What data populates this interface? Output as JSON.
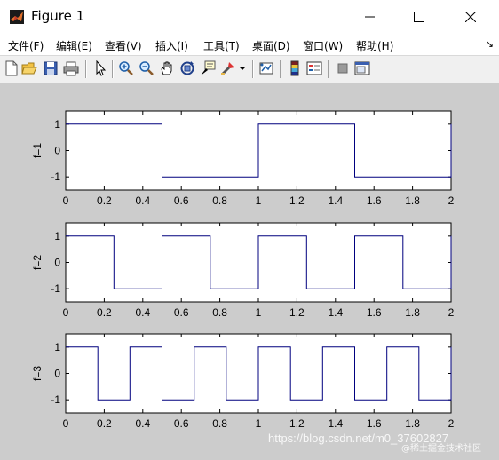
{
  "window": {
    "title": "Figure 1",
    "controls": [
      "minimize",
      "maximize",
      "close"
    ]
  },
  "menu": {
    "items": [
      "文件(F)",
      "编辑(E)",
      "查看(V)",
      "插入(I)",
      "工具(T)",
      "桌面(D)",
      "窗口(W)",
      "帮助(H)"
    ]
  },
  "toolbar": {
    "icons": [
      "new-figure-icon",
      "open-file-icon",
      "save-icon",
      "print-icon",
      "arrow-select-icon",
      "zoom-in-icon",
      "zoom-out-icon",
      "pan-hand-icon",
      "rotate-3d-icon",
      "data-cursor-icon",
      "brush-icon",
      "brush-dropdown-icon",
      "link-plot-icon",
      "colorbar-icon",
      "legend-icon",
      "hide-plot-tools-icon",
      "show-plot-tools-icon"
    ]
  },
  "colors": {
    "line": "#00007f",
    "axes_bg": "#ffffff",
    "figure_bg": "#cccccc"
  },
  "chart_data": [
    {
      "type": "line",
      "ylabel": "f=1",
      "xlim": [
        0,
        2
      ],
      "ylim": [
        -1.5,
        1.5
      ],
      "xticks": [
        "0",
        "0.2",
        "0.4",
        "0.6",
        "0.8",
        "1",
        "1.2",
        "1.4",
        "1.6",
        "1.8",
        "2"
      ],
      "yticks": [
        "1",
        "0",
        "-1"
      ],
      "series": [
        {
          "x": [
            0,
            0.5,
            0.5,
            1,
            1,
            1.5,
            1.5,
            2,
            2
          ],
          "y": [
            1,
            1,
            -1,
            -1,
            1,
            1,
            -1,
            -1,
            1
          ]
        }
      ]
    },
    {
      "type": "line",
      "ylabel": "f=2",
      "xlim": [
        0,
        2
      ],
      "ylim": [
        -1.5,
        1.5
      ],
      "xticks": [
        "0",
        "0.2",
        "0.4",
        "0.6",
        "0.8",
        "1",
        "1.2",
        "1.4",
        "1.6",
        "1.8",
        "2"
      ],
      "yticks": [
        "1",
        "0",
        "-1"
      ],
      "series": [
        {
          "x": [
            0,
            0.25,
            0.25,
            0.5,
            0.5,
            0.75,
            0.75,
            1,
            1,
            1.25,
            1.25,
            1.5,
            1.5,
            1.75,
            1.75,
            2,
            2
          ],
          "y": [
            1,
            1,
            -1,
            -1,
            1,
            1,
            -1,
            -1,
            1,
            1,
            -1,
            -1,
            1,
            1,
            -1,
            -1,
            1
          ]
        }
      ]
    },
    {
      "type": "line",
      "ylabel": "f=3",
      "xlim": [
        0,
        2
      ],
      "ylim": [
        -1.5,
        1.5
      ],
      "xticks": [
        "0",
        "0.2",
        "0.4",
        "0.6",
        "0.8",
        "1",
        "1.2",
        "1.4",
        "1.6",
        "1.8",
        "2"
      ],
      "yticks": [
        "1",
        "0",
        "-1"
      ],
      "series": [
        {
          "x": [
            0,
            0.1667,
            0.1667,
            0.3333,
            0.3333,
            0.5,
            0.5,
            0.6667,
            0.6667,
            0.8333,
            0.8333,
            1,
            1,
            1.1667,
            1.1667,
            1.3333,
            1.3333,
            1.5,
            1.5,
            1.6667,
            1.6667,
            1.8333,
            1.8333,
            2,
            2
          ],
          "y": [
            1,
            1,
            -1,
            -1,
            1,
            1,
            -1,
            -1,
            1,
            1,
            -1,
            -1,
            1,
            1,
            -1,
            -1,
            1,
            1,
            -1,
            -1,
            1,
            1,
            -1,
            -1,
            1
          ]
        }
      ]
    }
  ],
  "watermark": {
    "text": "https://blog.csdn.net/m0_37602827",
    "subtext": "@稀土掘金技术社区"
  }
}
